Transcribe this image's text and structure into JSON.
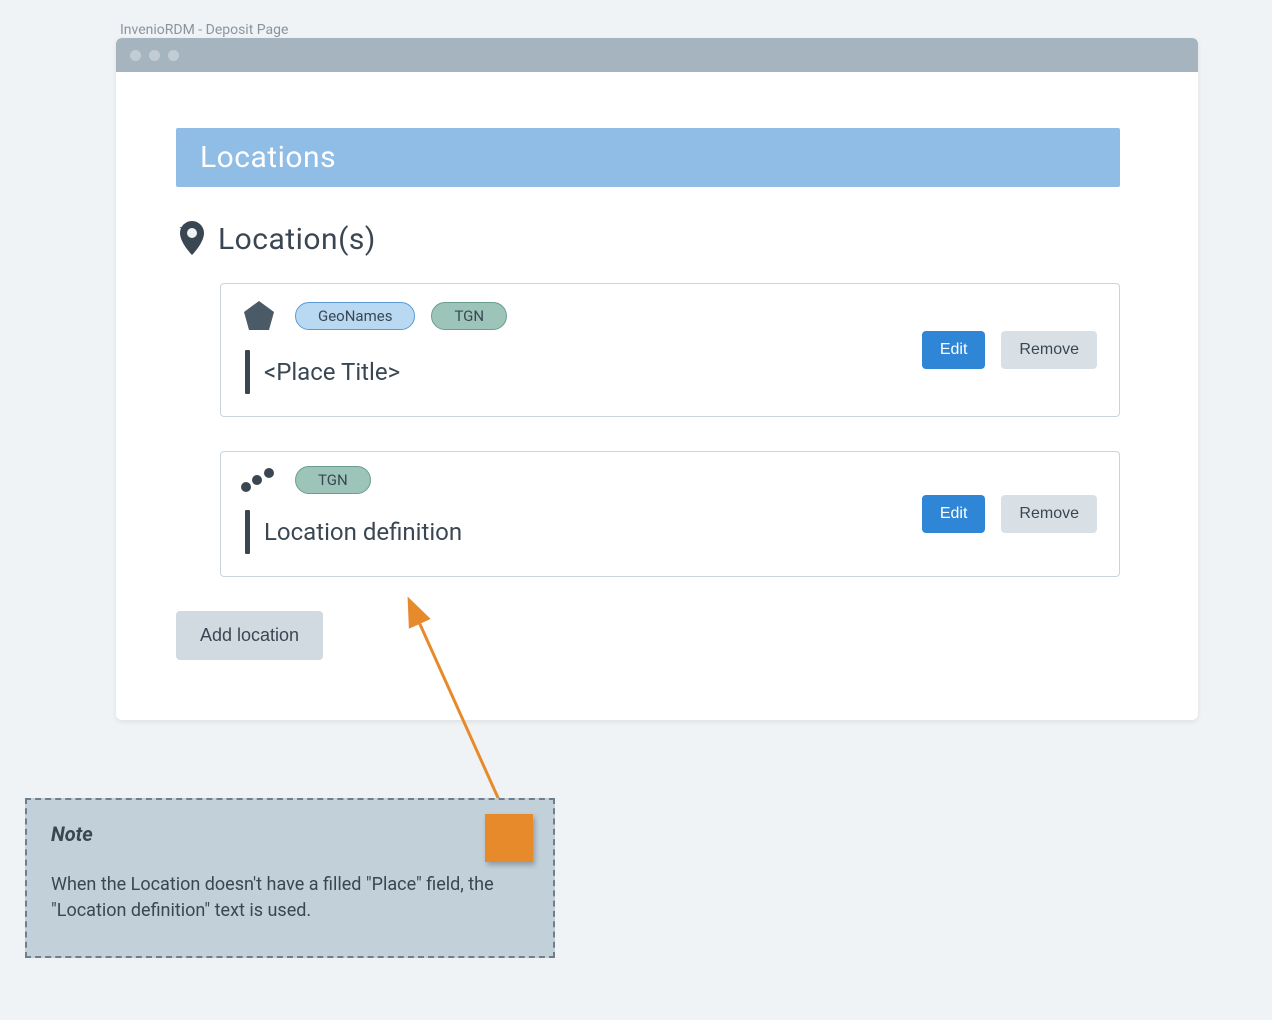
{
  "window_label": "InvenioRDM - Deposit Page",
  "section_header": "Locations",
  "field_title": "Location(s)",
  "cards": [
    {
      "icon": "pentagon",
      "tags": [
        "GeoNames",
        "TGN"
      ],
      "title": "<Place Title>",
      "edit": "Edit",
      "remove": "Remove"
    },
    {
      "icon": "dots",
      "tags": [
        "TGN"
      ],
      "title": "Location definition",
      "edit": "Edit",
      "remove": "Remove"
    }
  ],
  "add_button": "Add location",
  "note": {
    "heading": "Note",
    "body": "When the Location doesn't have a filled \"Place\" field, the \"Location definition\" text is used."
  }
}
